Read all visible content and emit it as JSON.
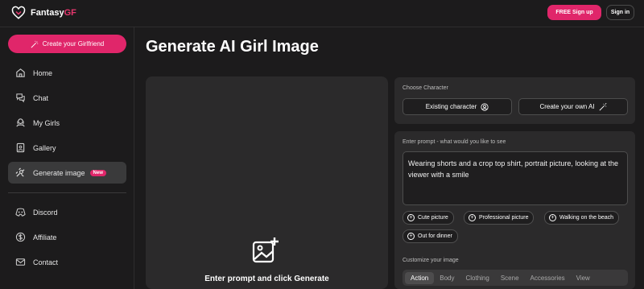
{
  "brand": {
    "name_part1": "Fantasy",
    "name_part2": "GF",
    "accent_color": "#e0266a"
  },
  "header": {
    "signup_label": "FREE Sign up",
    "signin_label": "Sign in"
  },
  "sidebar": {
    "create_label": "Create your Girlfriend",
    "items": [
      {
        "label": "Home",
        "icon": "home-icon"
      },
      {
        "label": "Chat",
        "icon": "chat-icon"
      },
      {
        "label": "My Girls",
        "icon": "girls-icon"
      },
      {
        "label": "Gallery",
        "icon": "gallery-icon"
      },
      {
        "label": "Generate image",
        "icon": "generate-icon",
        "badge": "New",
        "active": true
      },
      {
        "label": "Discord",
        "icon": "discord-icon"
      },
      {
        "label": "Affiliate",
        "icon": "dollar-icon"
      },
      {
        "label": "Contact",
        "icon": "mail-icon"
      }
    ]
  },
  "main": {
    "title": "Generate AI Girl Image",
    "preview_text": "Enter prompt and click Generate"
  },
  "character": {
    "label": "Choose Character",
    "existing_label": "Existing character",
    "create_label": "Create your own AI"
  },
  "prompt": {
    "label": "Enter prompt - what would you like to see",
    "value": "Wearing shorts and a crop top shirt, portrait picture, looking at the viewer with a smile",
    "suggestions": [
      "Cute picture",
      "Professional picture",
      "Walking on the beach",
      "Out for dinner"
    ]
  },
  "customize": {
    "label": "Customize your image",
    "tabs": [
      "Action",
      "Body",
      "Clothing",
      "Scene",
      "Accessories",
      "View"
    ],
    "active_tab": "Action"
  }
}
